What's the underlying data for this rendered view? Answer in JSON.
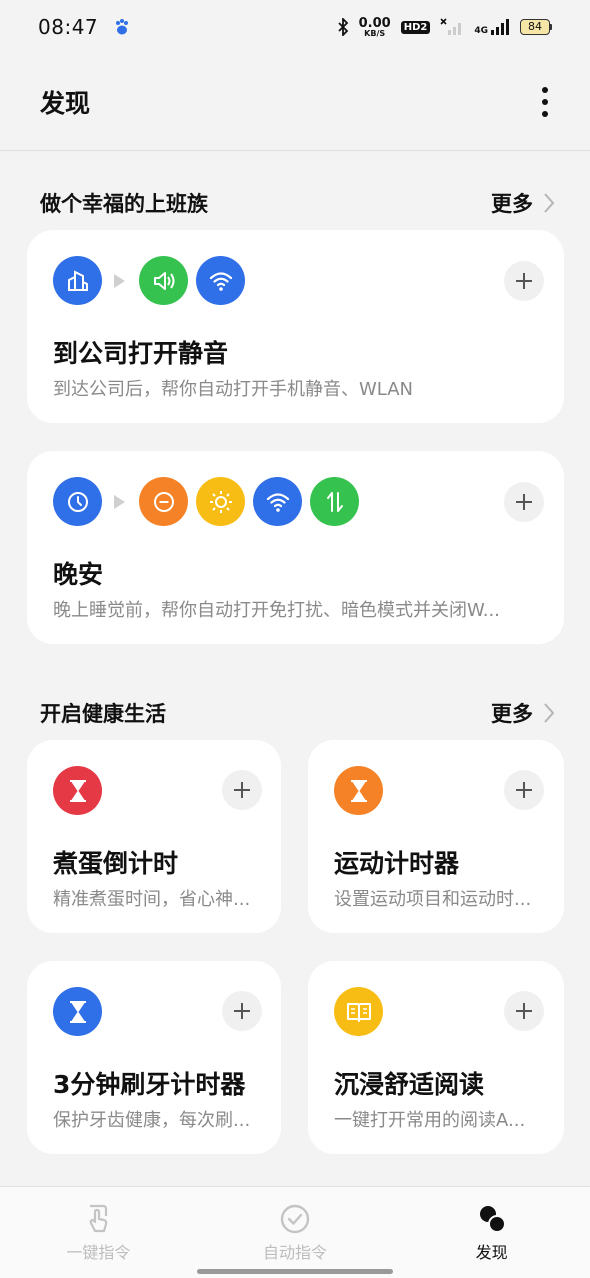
{
  "status_bar": {
    "time": "08:47",
    "net_speed_value": "0.00",
    "net_speed_unit": "KB/S",
    "hd_label": "HD2",
    "network_label": "4G",
    "battery_level": "84"
  },
  "header": {
    "title": "发现"
  },
  "sections": [
    {
      "title": "做个幸福的上班族",
      "more_label": "更多",
      "cards": [
        {
          "title": "到公司打开静音",
          "desc": "到达公司后，帮你自动打开手机静音、WLAN",
          "icons": [
            "building-icon",
            "volume-icon",
            "wifi-icon"
          ]
        },
        {
          "title": "晚安",
          "desc": "晚上睡觉前，帮你自动打开免打扰、暗色模式并关闭W...",
          "icons": [
            "clock-icon",
            "do-not-disturb-icon",
            "brightness-icon",
            "wifi-icon",
            "data-transfer-icon"
          ]
        }
      ]
    },
    {
      "title": "开启健康生活",
      "more_label": "更多",
      "cards": [
        {
          "title": "煮蛋倒计时",
          "desc": "精准煮蛋时间，省心神...",
          "icons": [
            "hourglass-icon"
          ]
        },
        {
          "title": "运动计时器",
          "desc": "设置运动项目和运动时...",
          "icons": [
            "hourglass-icon"
          ]
        },
        {
          "title": "3分钟刷牙计时器",
          "desc": "保护牙齿健康，每次刷...",
          "icons": [
            "hourglass-icon"
          ]
        },
        {
          "title": "沉浸舒适阅读",
          "desc": "一键打开常用的阅读A...",
          "icons": [
            "book-icon"
          ]
        }
      ]
    }
  ],
  "bottom_nav": [
    {
      "label": "一键指令",
      "icon": "tap-icon",
      "active": false
    },
    {
      "label": "自动指令",
      "icon": "check-circle-icon",
      "active": false
    },
    {
      "label": "发现",
      "icon": "discover-icon",
      "active": true
    }
  ],
  "colors": {
    "blue": "#2f6fe8",
    "green": "#35c24f",
    "orange": "#f58226",
    "yellow": "#f8bd14",
    "red": "#e63946",
    "background": "#f3f3f3"
  }
}
